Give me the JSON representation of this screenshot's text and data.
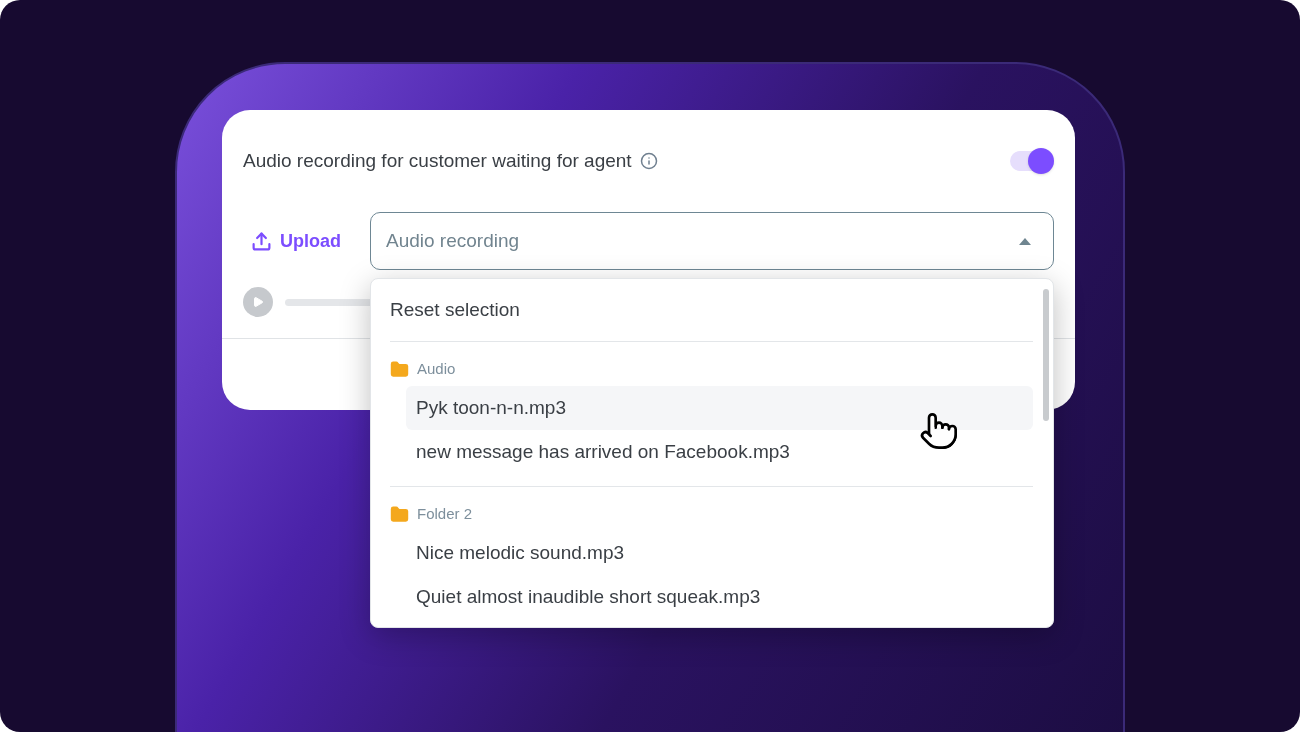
{
  "setting": {
    "label": "Audio recording for customer waiting for agent",
    "toggle_on": true
  },
  "upload_button": {
    "label": "Upload"
  },
  "select": {
    "placeholder": "Audio recording",
    "expanded": true
  },
  "dropdown": {
    "reset_label": "Reset selection",
    "groups": [
      {
        "folder": "Audio",
        "items": [
          {
            "label": "Pyk toon-n-n.mp3",
            "hovered": true
          },
          {
            "label": "new message has arrived on Facebook.mp3",
            "hovered": false
          }
        ]
      },
      {
        "folder": "Folder 2",
        "items": [
          {
            "label": "Nice melodic sound.mp3",
            "hovered": false
          },
          {
            "label": "Quiet almost inaudible short squeak.mp3",
            "hovered": false
          }
        ]
      }
    ]
  }
}
